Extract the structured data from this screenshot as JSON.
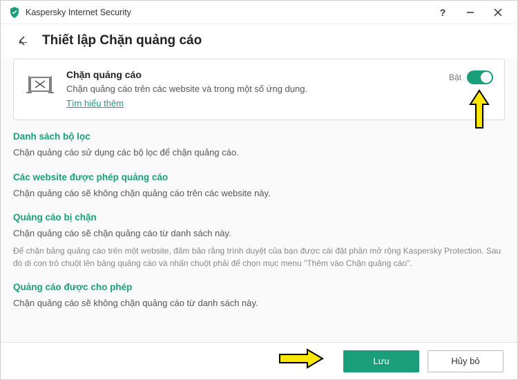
{
  "window": {
    "app_name": "Kaspersky Internet Security"
  },
  "header": {
    "page_title": "Thiết lập Chặn quảng cáo"
  },
  "card": {
    "title": "Chặn quảng cáo",
    "description": "Chặn quảng cáo trên các website và trong một số ứng dụng.",
    "link": "Tìm hiểu thêm",
    "toggle_state_label": "Bật"
  },
  "sections": {
    "filter_list": {
      "title": "Danh sách bộ lọc",
      "desc": "Chặn quảng cáo sử dụng các bộ lọc để chặn quảng cáo."
    },
    "allowed_sites": {
      "title": "Các website được phép quảng cáo",
      "desc": "Chặn quảng cáo sẽ không chặn quảng cáo trên các website này."
    },
    "blocked_ads": {
      "title": "Quảng cáo bị chặn",
      "desc": "Chặn quảng cáo sẽ chặn quảng cáo từ danh sách này.",
      "note": "Để chặn bảng quảng cáo trên một website, đảm bảo rằng trình duyệt của bạn được cài đặt phần mở rộng Kaspersky Protection. Sau đó di con trỏ chuột lên bảng quảng cáo và nhấn chuột phải để chọn mục menu \"Thêm vào Chặn quảng cáo\"."
    },
    "allowed_ads": {
      "title": "Quảng cáo được cho phép",
      "desc": "Chặn quảng cáo sẽ không chặn quảng cáo từ danh sách này."
    }
  },
  "footer": {
    "save": "Lưu",
    "cancel": "Hủy bỏ"
  }
}
